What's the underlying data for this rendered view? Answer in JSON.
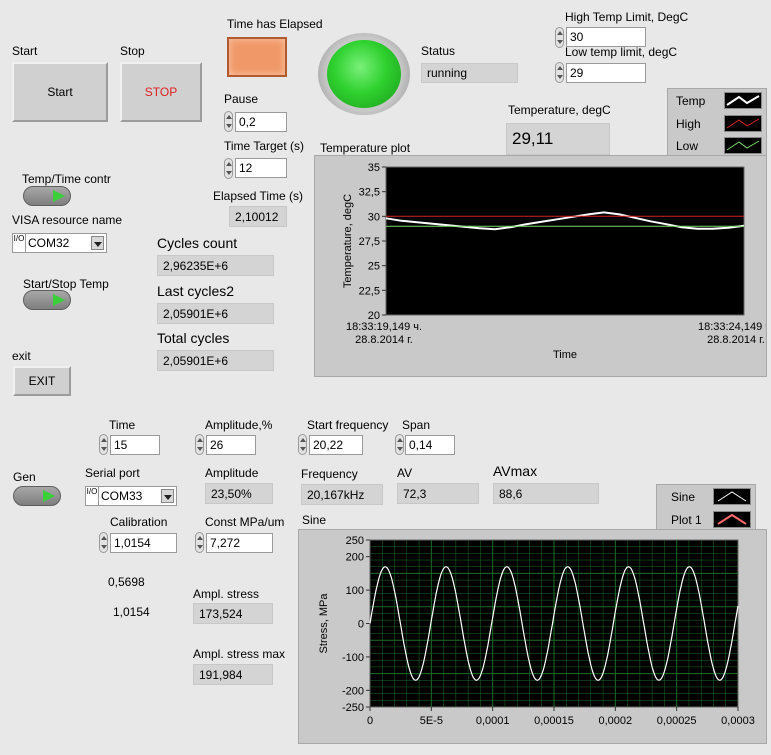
{
  "top": {
    "start_label": "Start",
    "start_button": "Start",
    "stop_label": "Stop",
    "stop_button": "STOP",
    "time_elapsed_label": "Time has Elapsed",
    "status_label": "Status",
    "status_value": "running",
    "high_limit_label": "High Temp Limit, DegC",
    "high_limit_value": "30",
    "low_limit_label": "Low temp limit, degC",
    "low_limit_value": "29",
    "pause_label": "Pause",
    "pause_value": "0,2",
    "time_target_label": "Time Target (s)",
    "time_target_value": "12",
    "elapsed_label": "Elapsed Time (s)",
    "elapsed_value": "2,10012",
    "temperature_label": "Temperature, degC",
    "temperature_value": "29,11",
    "temp_time_label": "Temp/Time contr",
    "visa_label": "VISA resource name",
    "visa_value": "COM32",
    "start_stop_temp_label": "Start/Stop Temp",
    "exit_label": "exit",
    "exit_button": "EXIT",
    "cycles_count_label": "Cycles count",
    "cycles_count_value": "2,96235E+6",
    "last_cycles_label": "Last cycles2",
    "last_cycles_value": "2,05901E+6",
    "total_cycles_label": "Total cycles",
    "total_cycles_value": "2,05901E+6"
  },
  "gen": {
    "gen_label": "Gen",
    "time_label": "Time",
    "time_value": "15",
    "amplitude_pct_label": "Amplitude,%",
    "amplitude_pct_value": "26",
    "start_freq_label": "Start frequency",
    "start_freq_value": "20,22",
    "span_label": "Span",
    "span_value": "0,14",
    "serial_label": "Serial port",
    "serial_value": "COM33",
    "amplitude_label": "Amplitude",
    "amplitude_value": "23,50%",
    "frequency_label": "Frequency",
    "frequency_value": "20,167kHz",
    "av_label": "AV",
    "av_value": "72,3",
    "avmax_label": "AVmax",
    "avmax_value": "88,6",
    "calibration_label": "Calibration",
    "calibration_value": "1,0154",
    "const_label": "Const MPa/um",
    "const_value": "7,272",
    "static1": "0,5698",
    "static2": "1,0154",
    "ampl_stress_label": "Ampl. stress",
    "ampl_stress_value": "173,524",
    "ampl_stress_max_label": "Ampl. stress max",
    "ampl_stress_max_value": "191,984"
  },
  "colors": {
    "led_green": "#2fd12f",
    "led_orange": "#f09868",
    "plot_bg": "#000000",
    "grid_green": "#1d6b2a"
  },
  "chart_data": [
    {
      "type": "line",
      "title": "Temperature plot",
      "xlabel": "Time",
      "ylabel": "Temperature, degC",
      "ylim": [
        20,
        35
      ],
      "yticks": [
        "35",
        "32,5",
        "30",
        "27,5",
        "25",
        "22,5",
        "20"
      ],
      "x_start_label": [
        "18:33:19,149 ч.",
        "28.8.2014 г."
      ],
      "x_end_label": [
        "18:33:24,149 ч.",
        "28.8.2014 г."
      ],
      "grid": false,
      "legend": "top-right",
      "legend_entries": [
        "Temp",
        "High",
        "Low"
      ],
      "series": [
        {
          "name": "Temp",
          "color": "#ffffff",
          "values": [
            29.8,
            29.55,
            29.4,
            29.25,
            29.1,
            28.95,
            28.8,
            28.7,
            28.9,
            29.2,
            29.45,
            29.7,
            29.95,
            30.2,
            30.4,
            30.2,
            29.85,
            29.5,
            29.2,
            28.9,
            28.75,
            28.75,
            28.85,
            29.05
          ]
        },
        {
          "name": "High",
          "color": "#d42424",
          "values": [
            30,
            30
          ]
        },
        {
          "name": "Low",
          "color": "#7ad86a",
          "values": [
            29,
            29
          ]
        }
      ]
    },
    {
      "type": "line",
      "title": "Sine",
      "xlabel": "",
      "ylabel": "Stress, MPa",
      "xlim": [
        0,
        0.0003
      ],
      "ylim": [
        -250,
        250
      ],
      "xticks": [
        "0",
        "5E-5",
        "0,0001",
        "0,00015",
        "0,0002",
        "0,00025",
        "0,0003"
      ],
      "yticks": [
        "250",
        "200",
        "100",
        "0",
        "-100",
        "-200",
        "-250"
      ],
      "grid": true,
      "legend": "top-right",
      "legend_entries": [
        "Sine",
        "Plot 1"
      ],
      "series": [
        {
          "name": "Sine",
          "color": "#ffffff",
          "amplitude": 170,
          "frequency_hz": 20167,
          "phase_deg": 0
        }
      ]
    }
  ]
}
